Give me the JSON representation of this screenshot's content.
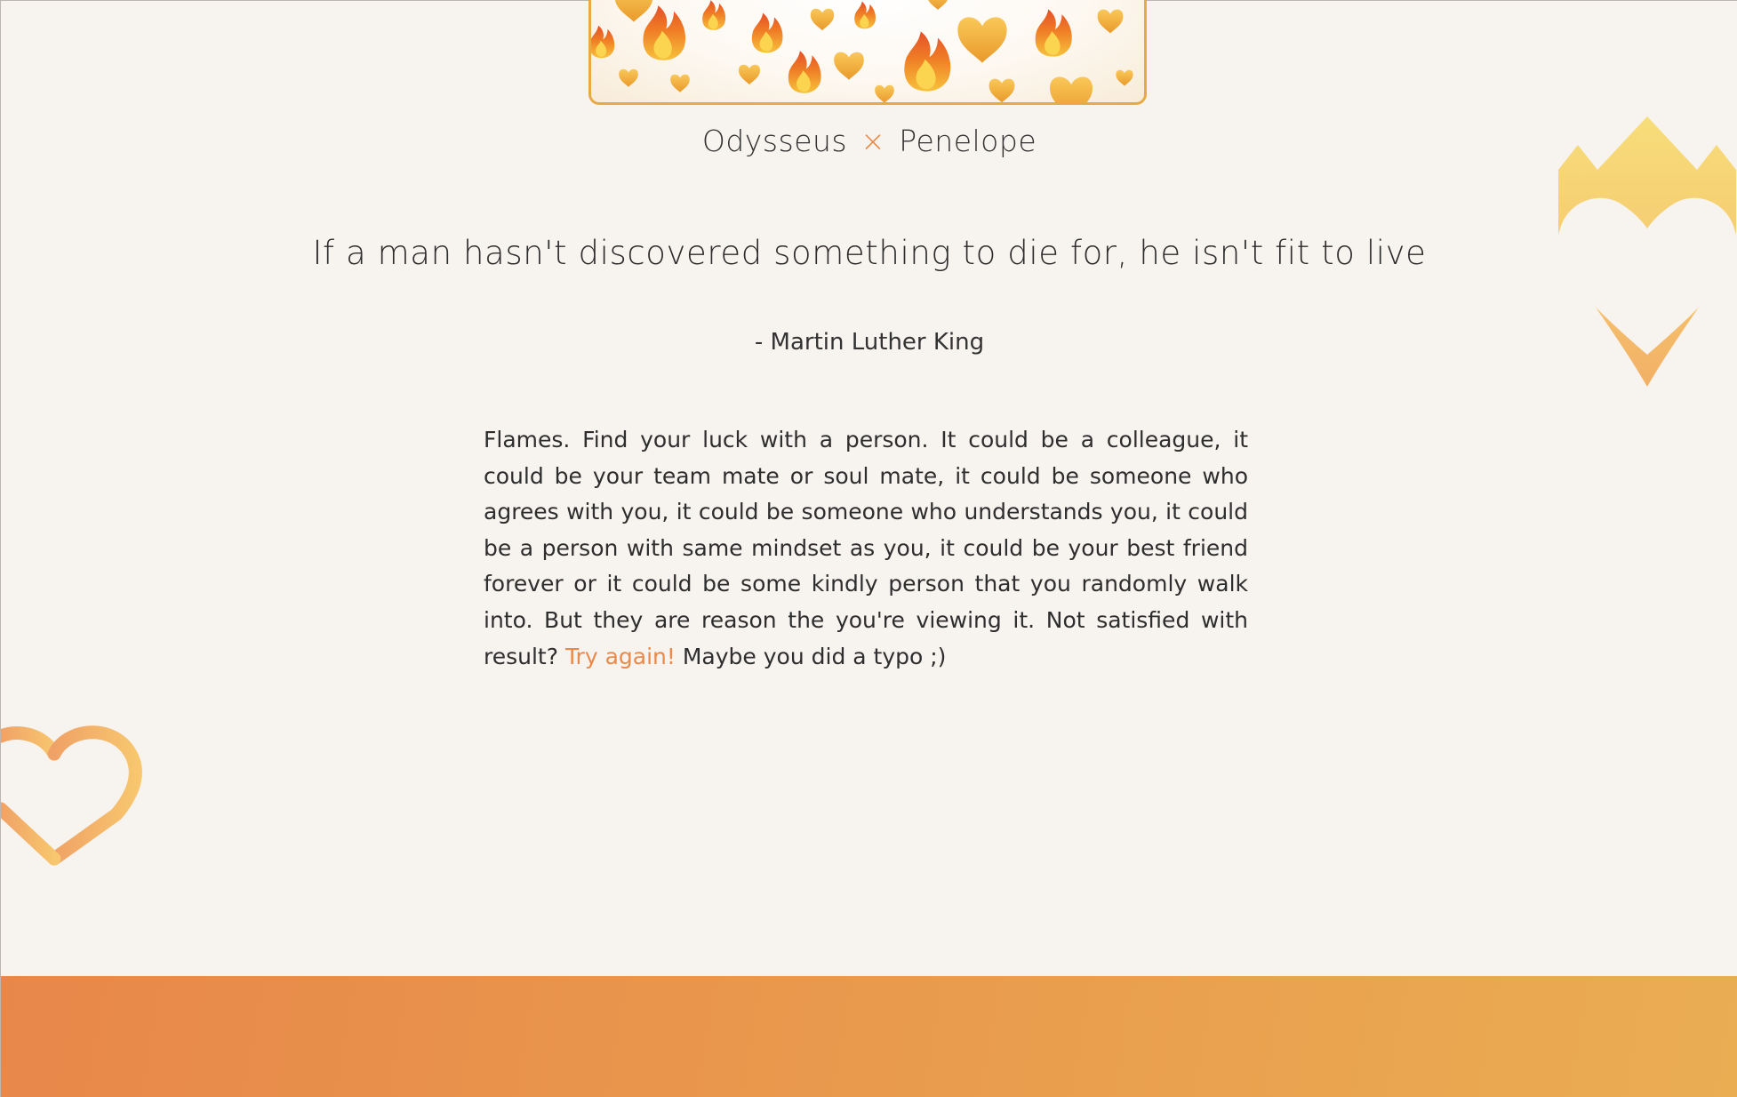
{
  "header": {
    "name_left": "Odysseus",
    "cross": "×",
    "name_right": "Penelope"
  },
  "quote": {
    "text": "If a man hasn't discovered something to die for, he isn't fit to live",
    "author": "- Martin Luther King"
  },
  "description": {
    "text_before": "Flames. Find your luck with a person. It could be a colleague, it could be your team mate or soul mate, it could be someone who agrees with you, it could be someone who understands you, it could be a person with same mindset as you, it could be your best friend forever or it could be some kindly person that you randomly walk into. But they are reason the you're viewing it. Not satisfied with result?",
    "try_again_link": "Try again!",
    "text_after": "Maybe you did a typo ;)"
  },
  "decorations": {
    "banner_icons": [
      "fire-icon",
      "heart-icon"
    ],
    "crown_heart": "crown-heart-icon",
    "outline_heart": "outline-heart-icon"
  },
  "colors": {
    "background": "#f7f3ef",
    "accent": "#ea8a4a",
    "banner_border": "#e9aa45",
    "footer_start": "#e8874a",
    "footer_end": "#eaad52",
    "crown_yellow": "#f7dd7a",
    "heart_orange": "#f2b569"
  }
}
